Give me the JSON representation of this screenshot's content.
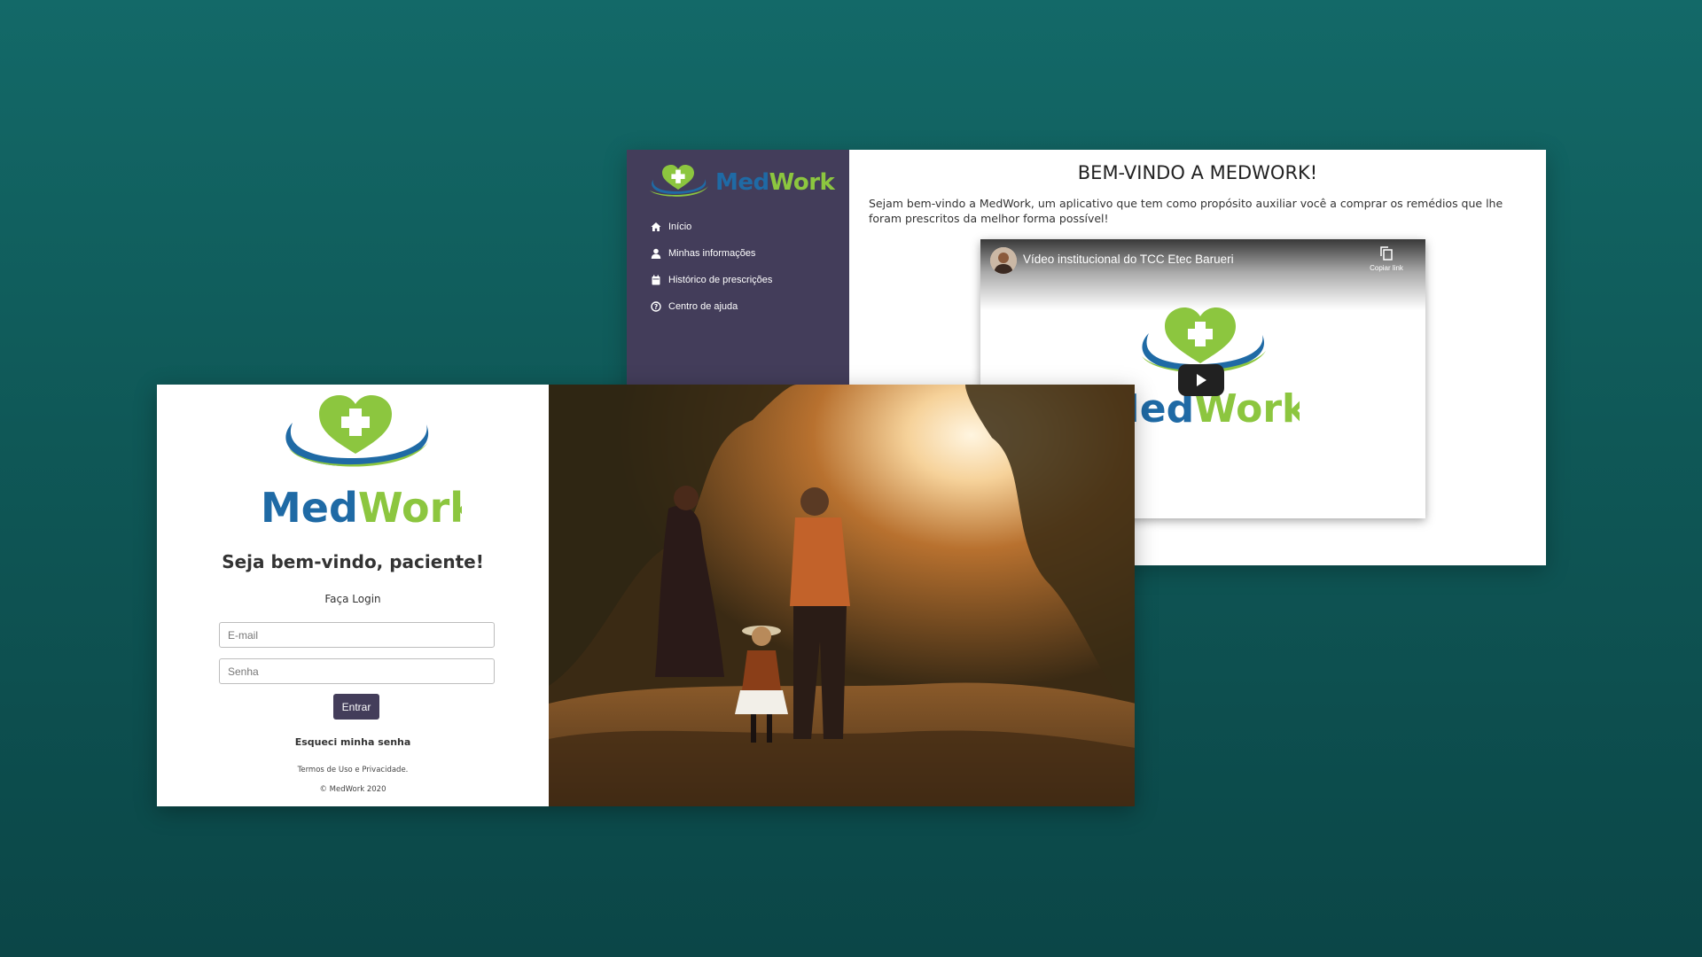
{
  "dashboard": {
    "brand": {
      "part1": "Med",
      "part2": "Work"
    },
    "nav": [
      {
        "label": "Início",
        "icon": "home-icon"
      },
      {
        "label": "Minhas informações",
        "icon": "user-icon"
      },
      {
        "label": "Histórico de prescrições",
        "icon": "calendar-icon"
      },
      {
        "label": "Centro de ajuda",
        "icon": "help-circle-icon"
      }
    ],
    "title": "BEM-VINDO A MEDWORK!",
    "description": "Sejam bem-vindo a MedWork, um aplicativo que tem como propósito auxiliar você a comprar os remédios que lhe foram prescritos da melhor forma possível!",
    "video": {
      "title": "Vídeo institucional do TCC Etec Barueri",
      "copy_label": "Copiar link",
      "logo_text_part1": "Med",
      "logo_text_part2": "Work"
    }
  },
  "login": {
    "brand": {
      "part1": "Med",
      "part2": "Work"
    },
    "welcome": "Seja bem-vindo, paciente!",
    "subtitle": "Faça Login",
    "email_placeholder": "E-mail",
    "password_placeholder": "Senha",
    "submit_label": "Entrar",
    "forgot_label": "Esqueci minha senha",
    "terms": "Termos de Uso e Privacidade.",
    "copyright": "© MedWork 2020"
  },
  "colors": {
    "brand_green": "#8cc63f",
    "brand_blue": "#1f6aa5",
    "sidebar": "#433d5a",
    "background": "#0f5857"
  }
}
